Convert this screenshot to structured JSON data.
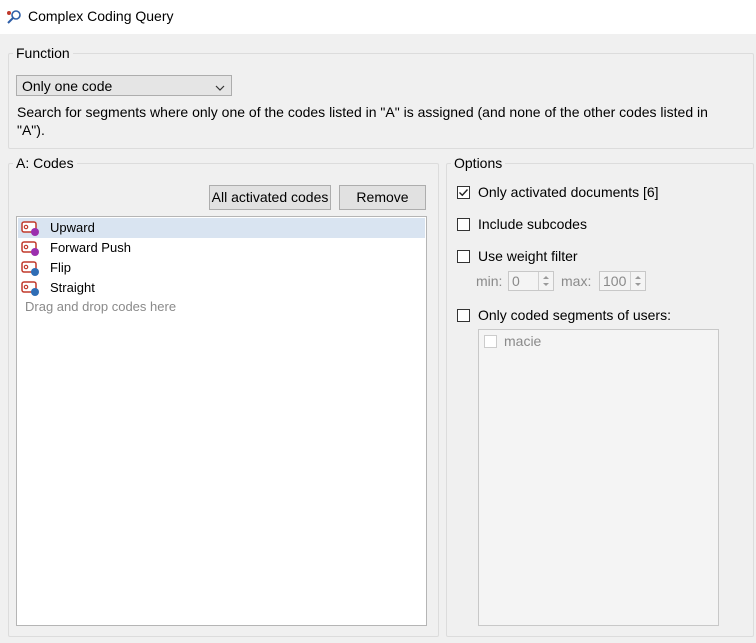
{
  "window": {
    "title": "Complex Coding Query"
  },
  "function_group": {
    "legend": "Function",
    "select_value": "Only one code",
    "description": "Search for segments where only one of the codes listed in \"A\" is assigned (and none of the other codes listed in \"A\")."
  },
  "codes_group": {
    "legend": "A: Codes",
    "all_activated_button": "All activated codes",
    "remove_button": "Remove",
    "items": [
      {
        "label": "Upward",
        "dot_color": "#9b2fae"
      },
      {
        "label": "Forward Push",
        "dot_color": "#9b2fae"
      },
      {
        "label": "Flip",
        "dot_color": "#2f6db5"
      },
      {
        "label": "Straight",
        "dot_color": "#2f6db5"
      }
    ],
    "drop_hint": "Drag and drop codes here"
  },
  "options_group": {
    "legend": "Options",
    "only_activated_docs": {
      "label": "Only activated documents [6]",
      "checked": true
    },
    "include_subcodes": {
      "label": "Include subcodes",
      "checked": false
    },
    "use_weight_filter": {
      "label": "Use weight filter",
      "checked": false
    },
    "weight_min_label": "min:",
    "weight_min_value": "0",
    "weight_max_label": "max:",
    "weight_max_value": "100",
    "only_coded_users": {
      "label": "Only coded segments of users:",
      "checked": false
    },
    "users": [
      {
        "name": "macie",
        "checked": false
      }
    ]
  },
  "colors": {
    "selected_row": "#d9e4f1",
    "code_tag": "#c0392b"
  }
}
